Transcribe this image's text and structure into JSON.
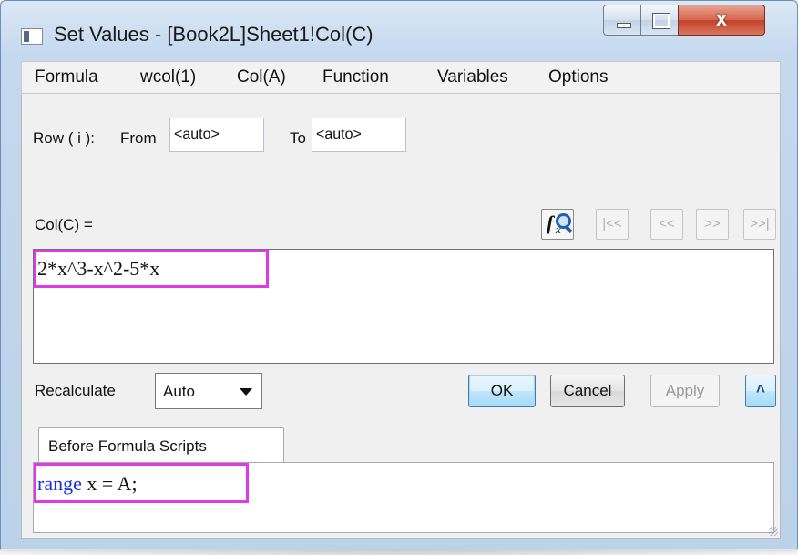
{
  "window": {
    "title": "Set Values - [Book2L]Sheet1!Col(C)",
    "close_glyph": "x",
    "accent_color": "#e239e8"
  },
  "menu": [
    {
      "label": "Formula"
    },
    {
      "label": "wcol(1)"
    },
    {
      "label": "Col(A)"
    },
    {
      "label": "Function"
    },
    {
      "label": "Variables"
    },
    {
      "label": "Options"
    }
  ],
  "row_range": {
    "row_label": "Row ( i ):",
    "from_label": "From",
    "from_value": "<auto>",
    "to_label": "To",
    "to_value": "<auto>"
  },
  "formula": {
    "target_label": "Col(C) =",
    "expression": "2*x^3-x^2-5*x"
  },
  "nav_buttons": [
    {
      "label": "|<<",
      "icon": "first-icon"
    },
    {
      "label": "<<",
      "icon": "previous-icon"
    },
    {
      "label": ">>",
      "icon": "next-icon"
    },
    {
      "label": ">>|",
      "icon": "last-icon"
    }
  ],
  "recalculate": {
    "label": "Recalculate",
    "value": "Auto"
  },
  "buttons": {
    "ok": "OK",
    "cancel": "Cancel",
    "apply": "Apply",
    "collapse": "˄"
  },
  "scripts_tab": {
    "label": "Before Formula Scripts",
    "keyword": "range",
    "code_rest": " x = A;"
  }
}
